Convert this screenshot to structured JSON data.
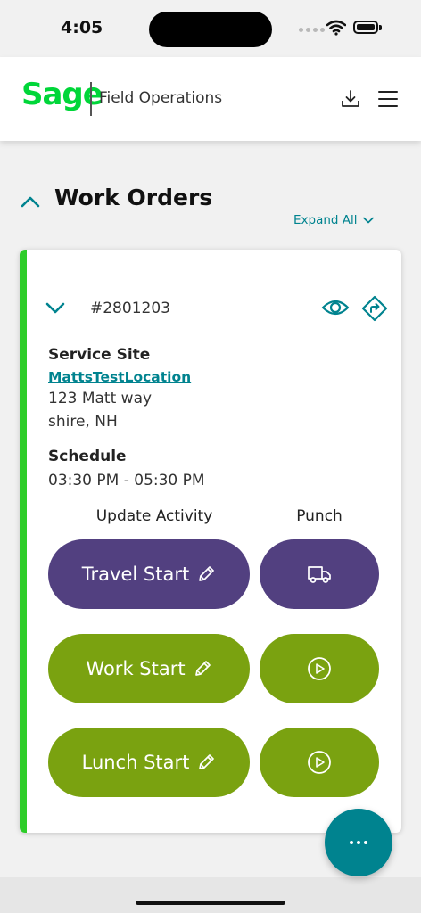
{
  "status_bar": {
    "time": "4:05"
  },
  "header": {
    "logo_text": "Sage",
    "app_title": "Field Operations",
    "brand_color": "#00d639"
  },
  "section": {
    "title": "Work Orders",
    "expand_all_label": "Expand All"
  },
  "work_order": {
    "number": "#2801203",
    "service_site_label": "Service Site",
    "location_link": "MattsTestLocation",
    "address_line1": "123 Matt way",
    "address_line2": "shire, NH",
    "schedule_label": "Schedule",
    "schedule_value": "03:30 PM - 05:30 PM",
    "update_activity_label": "Update Activity",
    "punch_label": "Punch",
    "activities": [
      {
        "label": "Travel Start",
        "punch_icon": "truck-icon",
        "color": "#524080"
      },
      {
        "label": "Work Start",
        "punch_icon": "play-circle-icon",
        "color": "#7aa210"
      },
      {
        "label": "Lunch Start",
        "punch_icon": "play-circle-icon",
        "color": "#7aa210"
      }
    ],
    "accent_color": "#2dcd29"
  },
  "colors": {
    "teal": "#00838f"
  }
}
